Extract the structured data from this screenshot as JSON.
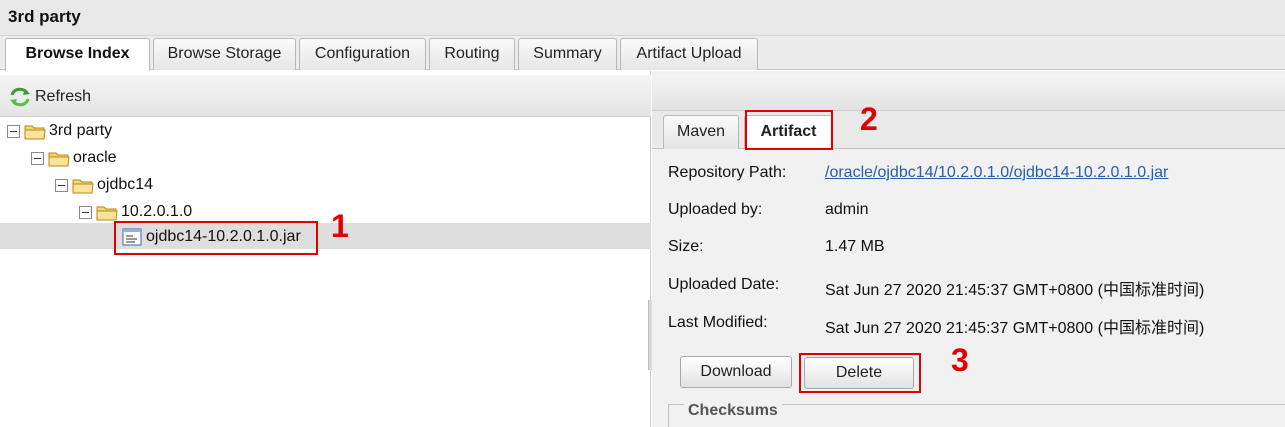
{
  "panel": {
    "title": "3rd party"
  },
  "tabs": [
    {
      "label": "Browse Index",
      "active": true
    },
    {
      "label": "Browse Storage",
      "active": false
    },
    {
      "label": "Configuration",
      "active": false
    },
    {
      "label": "Routing",
      "active": false
    },
    {
      "label": "Summary",
      "active": false
    },
    {
      "label": "Artifact Upload",
      "active": false
    }
  ],
  "toolbar": {
    "refresh_label": "Refresh",
    "refresh_icon": "refresh-icon"
  },
  "tree": {
    "nodes": [
      {
        "label": "3rd party",
        "type": "folder",
        "depth": 0
      },
      {
        "label": "oracle",
        "type": "folder",
        "depth": 1
      },
      {
        "label": "ojdbc14",
        "type": "folder",
        "depth": 2
      },
      {
        "label": "10.2.0.1.0",
        "type": "folder",
        "depth": 3
      },
      {
        "label": "ojdbc14-10.2.0.1.0.jar",
        "type": "file",
        "depth": 4,
        "selected": true
      }
    ]
  },
  "subtabs": [
    {
      "label": "Maven",
      "active": false
    },
    {
      "label": "Artifact",
      "active": true
    }
  ],
  "artifact": {
    "repository_path_label": "Repository Path:",
    "repository_path_value": "/oracle/ojdbc14/10.2.0.1.0/ojdbc14-10.2.0.1.0.jar",
    "uploaded_by_label": "Uploaded by:",
    "uploaded_by_value": "admin",
    "size_label": "Size:",
    "size_value": "1.47 MB",
    "uploaded_date_label": "Uploaded Date:",
    "uploaded_date_value": "Sat Jun 27 2020 21:45:37 GMT+0800 (中国标准时间)",
    "last_modified_label": "Last Modified:",
    "last_modified_value": "Sat Jun 27 2020 21:45:37 GMT+0800 (中国标准时间)"
  },
  "buttons": {
    "download_label": "Download",
    "delete_label": "Delete"
  },
  "checksums": {
    "legend": "Checksums"
  },
  "annotations": {
    "one": "1",
    "two": "2",
    "three": "3",
    "color": "#e00000"
  },
  "colors": {
    "link": "#2a5dab",
    "selected_row": "#dedede",
    "folder": "#f2c94c"
  }
}
